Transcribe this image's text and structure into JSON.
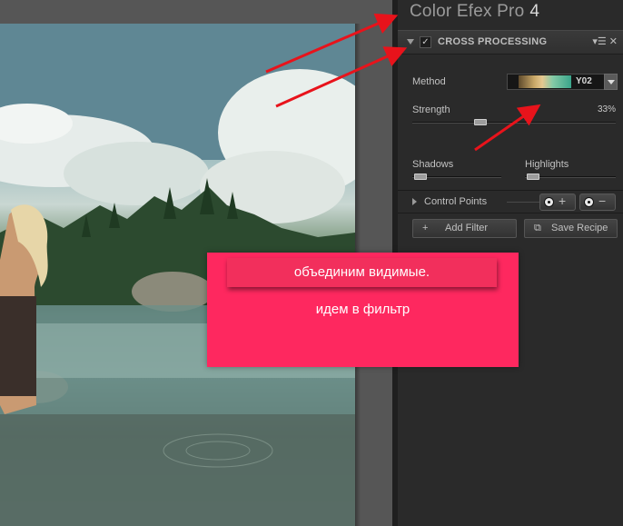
{
  "app": {
    "title": "Color Efex Pro",
    "version": "4"
  },
  "filter": {
    "name": "CROSS PROCESSING",
    "enabled": true,
    "header_icons": [
      "menu-icon",
      "close-icon"
    ],
    "method": {
      "label": "Method",
      "value": "Y02"
    },
    "strength": {
      "label": "Strength",
      "value_text": "33%",
      "value": 33
    },
    "shadows": {
      "label": "Shadows",
      "value": 0
    },
    "highlights": {
      "label": "Highlights",
      "value": 0
    }
  },
  "control_points": {
    "label": "Control Points",
    "add": "+",
    "remove": "−"
  },
  "buttons": {
    "add_filter": "Add Filter",
    "save_recipe": "Save Recipe"
  },
  "annotation": {
    "line1": "объединим видимые.",
    "line2": "идем в фильтр",
    "background": "#fe285f",
    "arrow_color": "#e8131b"
  },
  "colors": {
    "panel_bg": "#2a2a2a",
    "canvas_bg": "#565656"
  }
}
